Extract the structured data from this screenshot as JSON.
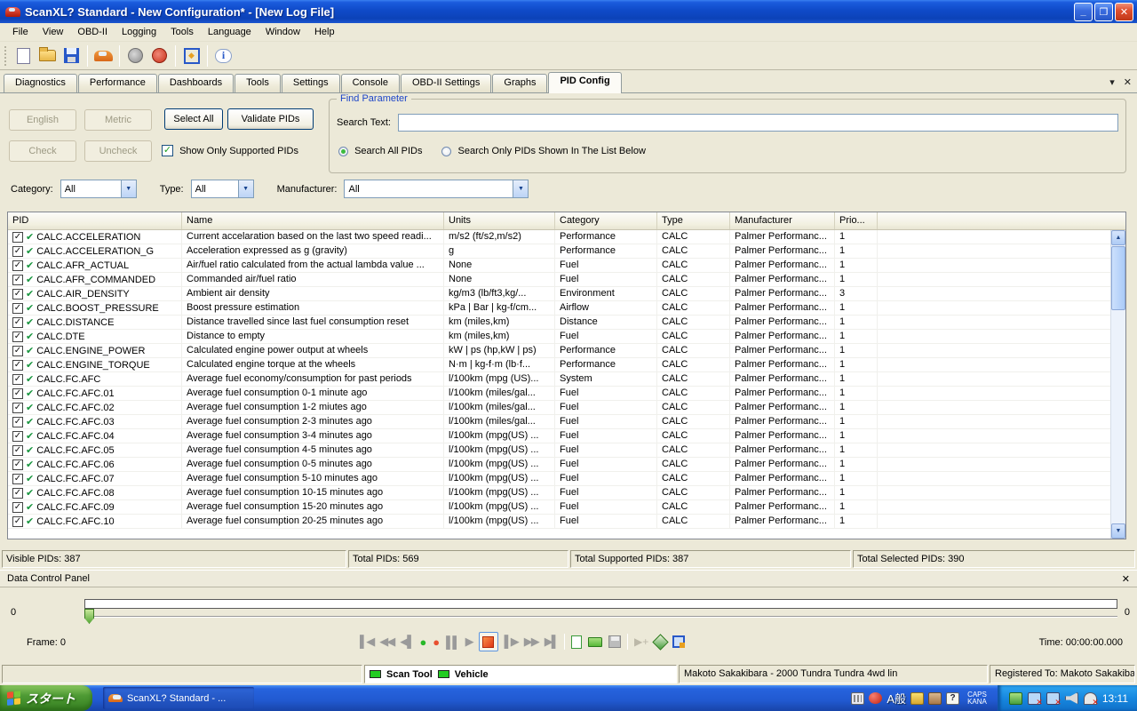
{
  "window": {
    "title": "ScanXL? Standard - New Configuration* - [New Log File]",
    "menus": [
      "File",
      "View",
      "OBD-II",
      "Logging",
      "Tools",
      "Language",
      "Window",
      "Help"
    ],
    "buttons": {
      "minimize": "_",
      "restore": "❐",
      "close": "✕"
    }
  },
  "toolbar": {
    "icons": [
      "new-file",
      "open-file",
      "save-file",
      "vehicle",
      "connect",
      "disconnect",
      "dashboard",
      "about-info"
    ]
  },
  "tabs": {
    "items": [
      "Diagnostics",
      "Performance",
      "Dashboards",
      "Tools",
      "Settings",
      "Console",
      "OBD-II Settings",
      "Graphs",
      "PID Config"
    ],
    "active_index": 8,
    "menu_arrow": "▾",
    "close": "✕"
  },
  "pid_panel": {
    "english_button": "English",
    "metric_button": "Metric",
    "select_all_button": "Select All",
    "validate_button": "Validate PIDs",
    "check_button": "Check",
    "uncheck_button": "Uncheck",
    "show_only_supported_label": "Show Only Supported PIDs",
    "show_only_supported_checked": "✓",
    "find": {
      "group_title": "Find Parameter",
      "search_label": "Search Text:",
      "search_value": "",
      "radio_all": "Search All PIDs",
      "radio_shown": "Search Only PIDs Shown In The List Below"
    },
    "filters": {
      "category_label": "Category:",
      "category_value": "All",
      "type_label": "Type:",
      "type_value": "All",
      "manufacturer_label": "Manufacturer:",
      "manufacturer_value": "All",
      "arrow": "▼"
    }
  },
  "table": {
    "columns": [
      "PID",
      "Name",
      "Units",
      "Category",
      "Type",
      "Manufacturer",
      "Prio...",
      ""
    ],
    "checkbox_glyph": "✓",
    "supported_glyph": "✔",
    "rows": [
      {
        "pid": "CALC.ACCELERATION",
        "name": "Current accelaration based on the last two speed readi...",
        "units": "m/s2  (ft/s2,m/s2)",
        "category": "Performance",
        "type": "CALC",
        "manufacturer": "Palmer Performanc...",
        "prio": "1"
      },
      {
        "pid": "CALC.ACCELERATION_G",
        "name": "Acceleration expressed as g (gravity)",
        "units": "g",
        "category": "Performance",
        "type": "CALC",
        "manufacturer": "Palmer Performanc...",
        "prio": "1"
      },
      {
        "pid": "CALC.AFR_ACTUAL",
        "name": "Air/fuel ratio calculated from the actual lambda value ...",
        "units": "None",
        "category": "Fuel",
        "type": "CALC",
        "manufacturer": "Palmer Performanc...",
        "prio": "1"
      },
      {
        "pid": "CALC.AFR_COMMANDED",
        "name": "Commanded air/fuel ratio",
        "units": "None",
        "category": "Fuel",
        "type": "CALC",
        "manufacturer": "Palmer Performanc...",
        "prio": "1"
      },
      {
        "pid": "CALC.AIR_DENSITY",
        "name": "Ambient air density",
        "units": "kg/m3  (lb/ft3,kg/...",
        "category": "Environment",
        "type": "CALC",
        "manufacturer": "Palmer Performanc...",
        "prio": "3"
      },
      {
        "pid": "CALC.BOOST_PRESSURE",
        "name": "Boost pressure estimation",
        "units": "kPa | Bar | kg-f/cm...",
        "category": "Airflow",
        "type": "CALC",
        "manufacturer": "Palmer Performanc...",
        "prio": "1"
      },
      {
        "pid": "CALC.DISTANCE",
        "name": "Distance travelled since last fuel consumption reset",
        "units": "km  (miles,km)",
        "category": "Distance",
        "type": "CALC",
        "manufacturer": "Palmer Performanc...",
        "prio": "1"
      },
      {
        "pid": "CALC.DTE",
        "name": "Distance to empty",
        "units": "km  (miles,km)",
        "category": "Fuel",
        "type": "CALC",
        "manufacturer": "Palmer Performanc...",
        "prio": "1"
      },
      {
        "pid": "CALC.ENGINE_POWER",
        "name": "Calculated engine power output at wheels",
        "units": "kW | ps  (hp,kW | ps)",
        "category": "Performance",
        "type": "CALC",
        "manufacturer": "Palmer Performanc...",
        "prio": "1"
      },
      {
        "pid": "CALC.ENGINE_TORQUE",
        "name": "Calculated engine torque at the wheels",
        "units": "N·m | kg-f·m  (lb·f...",
        "category": "Performance",
        "type": "CALC",
        "manufacturer": "Palmer Performanc...",
        "prio": "1"
      },
      {
        "pid": "CALC.FC.AFC",
        "name": "Average fuel economy/consumption for past periods",
        "units": "l/100km  (mpg (US)...",
        "category": "System",
        "type": "CALC",
        "manufacturer": "Palmer Performanc...",
        "prio": "1"
      },
      {
        "pid": "CALC.FC.AFC.01",
        "name": "Average fuel consumption 0-1 minute ago",
        "units": "l/100km  (miles/gal...",
        "category": "Fuel",
        "type": "CALC",
        "manufacturer": "Palmer Performanc...",
        "prio": "1"
      },
      {
        "pid": "CALC.FC.AFC.02",
        "name": "Average fuel consumption 1-2 miutes ago",
        "units": "l/100km  (miles/gal...",
        "category": "Fuel",
        "type": "CALC",
        "manufacturer": "Palmer Performanc...",
        "prio": "1"
      },
      {
        "pid": "CALC.FC.AFC.03",
        "name": "Average fuel consumption 2-3 minutes ago",
        "units": "l/100km  (miles/gal...",
        "category": "Fuel",
        "type": "CALC",
        "manufacturer": "Palmer Performanc...",
        "prio": "1"
      },
      {
        "pid": "CALC.FC.AFC.04",
        "name": "Average fuel consumption 3-4 minutes ago",
        "units": "l/100km  (mpg(US) ...",
        "category": "Fuel",
        "type": "CALC",
        "manufacturer": "Palmer Performanc...",
        "prio": "1"
      },
      {
        "pid": "CALC.FC.AFC.05",
        "name": "Average fuel consumption 4-5 minutes ago",
        "units": "l/100km  (mpg(US) ...",
        "category": "Fuel",
        "type": "CALC",
        "manufacturer": "Palmer Performanc...",
        "prio": "1"
      },
      {
        "pid": "CALC.FC.AFC.06",
        "name": "Average fuel consumption 0-5 minutes ago",
        "units": "l/100km  (mpg(US) ...",
        "category": "Fuel",
        "type": "CALC",
        "manufacturer": "Palmer Performanc...",
        "prio": "1"
      },
      {
        "pid": "CALC.FC.AFC.07",
        "name": "Average fuel consumption 5-10 minutes ago",
        "units": "l/100km  (mpg(US) ...",
        "category": "Fuel",
        "type": "CALC",
        "manufacturer": "Palmer Performanc...",
        "prio": "1"
      },
      {
        "pid": "CALC.FC.AFC.08",
        "name": "Average fuel consumption 10-15 minutes ago",
        "units": "l/100km  (mpg(US) ...",
        "category": "Fuel",
        "type": "CALC",
        "manufacturer": "Palmer Performanc...",
        "prio": "1"
      },
      {
        "pid": "CALC.FC.AFC.09",
        "name": "Average fuel consumption 15-20 minutes ago",
        "units": "l/100km  (mpg(US) ...",
        "category": "Fuel",
        "type": "CALC",
        "manufacturer": "Palmer Performanc...",
        "prio": "1"
      },
      {
        "pid": "CALC.FC.AFC.10",
        "name": "Average fuel consumption 20-25 minutes ago",
        "units": "l/100km  (mpg(US) ...",
        "category": "Fuel",
        "type": "CALC",
        "manufacturer": "Palmer Performanc...",
        "prio": "1"
      }
    ]
  },
  "status_bar": {
    "visible": "Visible PIDs: 387",
    "total": "Total PIDs: 569",
    "supported": "Total Supported PIDs: 387",
    "selected": "Total Selected PIDs: 390"
  },
  "data_control": {
    "title": "Data Control Panel",
    "close": "✕",
    "slider_left": "0",
    "slider_right": "0",
    "frame_text": "Frame:   0",
    "time_text": "Time:   00:00:00.000",
    "transport": [
      {
        "name": "skip-start",
        "glyph": "▌◀",
        "cls": "tico"
      },
      {
        "name": "rewind",
        "glyph": "◀◀",
        "cls": "tico"
      },
      {
        "name": "step-back",
        "glyph": "◀▌",
        "cls": "tico"
      },
      {
        "name": "record-green",
        "glyph": "●",
        "cls": "tico green"
      },
      {
        "name": "record-red",
        "glyph": "●",
        "cls": "tico red"
      },
      {
        "name": "pause",
        "glyph": "▌▌",
        "cls": "tico"
      },
      {
        "name": "play",
        "glyph": "▶",
        "cls": "tico"
      },
      {
        "name": "stop",
        "glyph": "",
        "cls": "stop"
      },
      {
        "name": "step-forward",
        "glyph": "▌▶",
        "cls": "tico"
      },
      {
        "name": "fast-forward",
        "glyph": "▶▶",
        "cls": "tico"
      },
      {
        "name": "skip-end",
        "glyph": "▶▌",
        "cls": "tico"
      }
    ]
  },
  "bottom_status": {
    "scan_tool_label": "Scan Tool",
    "vehicle_label": "Vehicle",
    "vehicle_info": "Makoto Sakakibara - 2000 Tundra Tundra 4wd lin",
    "registered": "Registered To: Makoto Sakakibara (Automiltech"
  },
  "taskbar": {
    "start_label": "スタート",
    "task_label": "ScanXL? Standard - ...",
    "ime_mode": "A般",
    "caps": "CAPS",
    "kana": "KANA",
    "clock": "13:11"
  },
  "colors": {
    "accent_blue": "#0F4AC8",
    "xp_beige": "#ECE9D8",
    "group_title_blue": "#1D45C8",
    "supported_green": "#18953E",
    "stop_orange": "#E03818",
    "taskbar_green": "#4E9A34"
  }
}
